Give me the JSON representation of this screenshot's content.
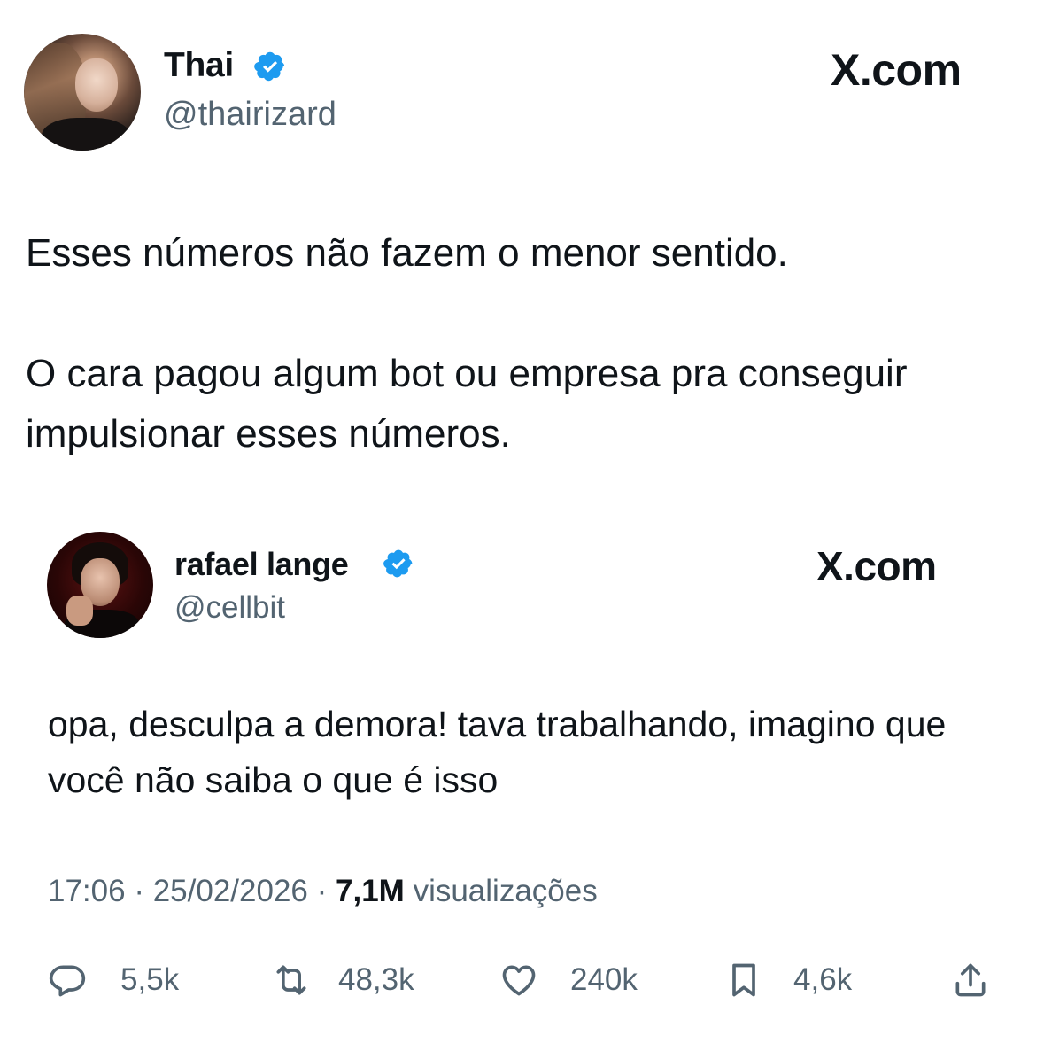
{
  "outer_tweet": {
    "display_name": "Thai",
    "handle": "@thairizard",
    "brand": "X.com",
    "paragraphs": [
      "Esses números não fazem o menor sentido.",
      "O cara pagou algum bot ou empresa pra conseguir impulsionar esses números."
    ],
    "verified_color": "#1d9bf0"
  },
  "inner_tweet": {
    "display_name": "rafael lange",
    "handle": "@cellbit",
    "brand": "X.com",
    "text": "opa, desculpa a demora! tava trabalhando, imagino que você não saiba o que é isso",
    "time": "17:06",
    "separator": "·",
    "date": "25/02/2026",
    "views_count": "7,1M",
    "views_label": "visualizações",
    "actions": {
      "reply": "5,5k",
      "retweet": "48,3k",
      "like": "240k",
      "bookmark": "4,6k"
    }
  },
  "icons": [
    "verified-badge-icon",
    "reply-icon",
    "retweet-icon",
    "like-icon",
    "bookmark-icon",
    "share-icon"
  ]
}
